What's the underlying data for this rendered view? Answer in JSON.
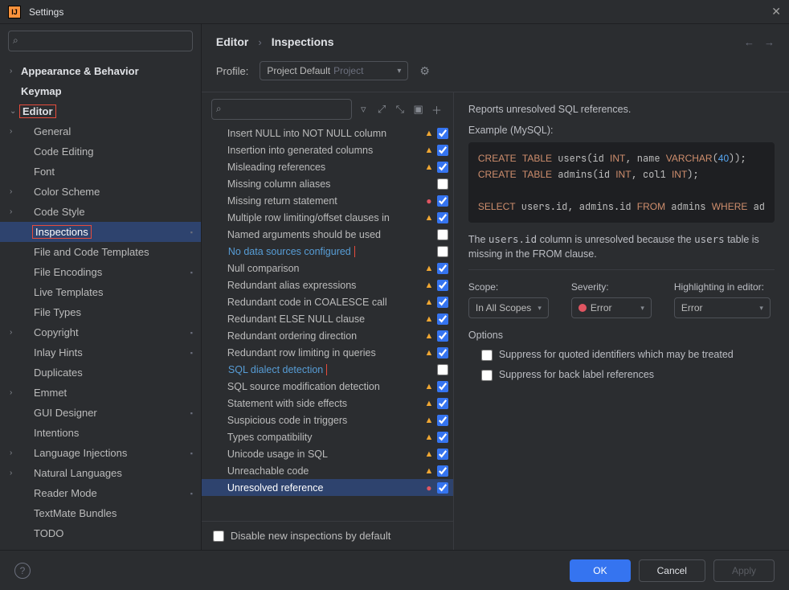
{
  "window": {
    "title": "Settings"
  },
  "breadcrumb": {
    "crumb1": "Editor",
    "crumb2": "Inspections"
  },
  "search": {
    "placeholder": ""
  },
  "sidebar": {
    "items": [
      {
        "label": "Appearance & Behavior",
        "bold": true,
        "arrow": ">",
        "indent": 0
      },
      {
        "label": "Keymap",
        "bold": true,
        "arrow": "",
        "indent": 0
      },
      {
        "label": "Editor",
        "bold": true,
        "arrow": "v",
        "indent": 0,
        "redbox": true
      },
      {
        "label": "General",
        "arrow": ">",
        "indent": 1
      },
      {
        "label": "Code Editing",
        "arrow": "",
        "indent": 1
      },
      {
        "label": "Font",
        "arrow": "",
        "indent": 1
      },
      {
        "label": "Color Scheme",
        "arrow": ">",
        "indent": 1
      },
      {
        "label": "Code Style",
        "arrow": ">",
        "indent": 1
      },
      {
        "label": "Inspections",
        "arrow": "",
        "indent": 1,
        "selected": true,
        "dot": true,
        "redbox": true
      },
      {
        "label": "File and Code Templates",
        "arrow": "",
        "indent": 1
      },
      {
        "label": "File Encodings",
        "arrow": "",
        "indent": 1,
        "dot": true
      },
      {
        "label": "Live Templates",
        "arrow": "",
        "indent": 1
      },
      {
        "label": "File Types",
        "arrow": "",
        "indent": 1
      },
      {
        "label": "Copyright",
        "arrow": ">",
        "indent": 1,
        "dot": true
      },
      {
        "label": "Inlay Hints",
        "arrow": "",
        "indent": 1,
        "dot": true
      },
      {
        "label": "Duplicates",
        "arrow": "",
        "indent": 1
      },
      {
        "label": "Emmet",
        "arrow": ">",
        "indent": 1
      },
      {
        "label": "GUI Designer",
        "arrow": "",
        "indent": 1,
        "dot": true
      },
      {
        "label": "Intentions",
        "arrow": "",
        "indent": 1
      },
      {
        "label": "Language Injections",
        "arrow": ">",
        "indent": 1,
        "dot": true
      },
      {
        "label": "Natural Languages",
        "arrow": ">",
        "indent": 1
      },
      {
        "label": "Reader Mode",
        "arrow": "",
        "indent": 1,
        "dot": true
      },
      {
        "label": "TextMate Bundles",
        "arrow": "",
        "indent": 1
      },
      {
        "label": "TODO",
        "arrow": "",
        "indent": 1
      }
    ]
  },
  "profile": {
    "label": "Profile:",
    "sel_main": "Project Default",
    "sel_gray": "Project"
  },
  "inspections": {
    "items": [
      {
        "name": "Insert NULL into NOT NULL column",
        "sev": "warn",
        "chk": true
      },
      {
        "name": "Insertion into generated columns",
        "sev": "warn",
        "chk": true
      },
      {
        "name": "Misleading references",
        "sev": "warn",
        "chk": true
      },
      {
        "name": "Missing column aliases",
        "sev": "",
        "chk": false
      },
      {
        "name": "Missing return statement",
        "sev": "err",
        "chk": true
      },
      {
        "name": "Multiple row limiting/offset clauses in",
        "sev": "warn",
        "chk": true
      },
      {
        "name": "Named arguments should be used",
        "sev": "",
        "chk": false
      },
      {
        "name": "No data sources configured",
        "sev": "",
        "chk": false,
        "link": true,
        "redbox": true
      },
      {
        "name": "Null comparison",
        "sev": "warn",
        "chk": true
      },
      {
        "name": "Redundant alias expressions",
        "sev": "warn",
        "chk": true
      },
      {
        "name": "Redundant code in COALESCE call",
        "sev": "warn",
        "chk": true
      },
      {
        "name": "Redundant ELSE NULL clause",
        "sev": "warn",
        "chk": true
      },
      {
        "name": "Redundant ordering direction",
        "sev": "warn",
        "chk": true
      },
      {
        "name": "Redundant row limiting in queries",
        "sev": "warn",
        "chk": true
      },
      {
        "name": "SQL dialect detection",
        "sev": "",
        "chk": false,
        "link": true,
        "redbox": true
      },
      {
        "name": "SQL source modification detection",
        "sev": "warn",
        "chk": true
      },
      {
        "name": "Statement with side effects",
        "sev": "warn",
        "chk": true
      },
      {
        "name": "Suspicious code in triggers",
        "sev": "warn",
        "chk": true
      },
      {
        "name": "Types compatibility",
        "sev": "warn",
        "chk": true
      },
      {
        "name": "Unicode usage in SQL",
        "sev": "warn",
        "chk": true
      },
      {
        "name": "Unreachable code",
        "sev": "warn",
        "chk": true
      },
      {
        "name": "Unresolved reference",
        "sev": "err",
        "chk": true,
        "selected": true
      }
    ],
    "disable_label": "Disable new inspections by default"
  },
  "detail": {
    "desc": "Reports unresolved SQL references.",
    "example_label": "Example (MySQL):",
    "code_html": "<span class='kw'>CREATE</span> <span class='kw'>TABLE</span> users(id <span class='kw'>INT</span>, name <span class='kw'>VARCHAR</span>(<span class='num'>40</span>));\n<span class='kw'>CREATE</span> <span class='kw'>TABLE</span> admins(id <span class='kw'>INT</span>, col1 <span class='kw'>INT</span>);\n\n<span class='kw'>SELECT</span> users.id, admins.id <span class='kw'>FROM</span> admins <span class='kw'>WHERE</span> ad",
    "explain_html": "The <code>users.id</code> column is unresolved because the <code>users</code> table is missing in the FROM clause.",
    "scope_label": "Scope:",
    "scope_value": "In All Scopes",
    "severity_label": "Severity:",
    "severity_value": "Error",
    "highlight_label": "Highlighting in editor:",
    "highlight_value": "Error",
    "options_label": "Options",
    "opt1": "Suppress for quoted identifiers which may be treated",
    "opt2": "Suppress for back label references"
  },
  "footer": {
    "ok": "OK",
    "cancel": "Cancel",
    "apply": "Apply"
  }
}
